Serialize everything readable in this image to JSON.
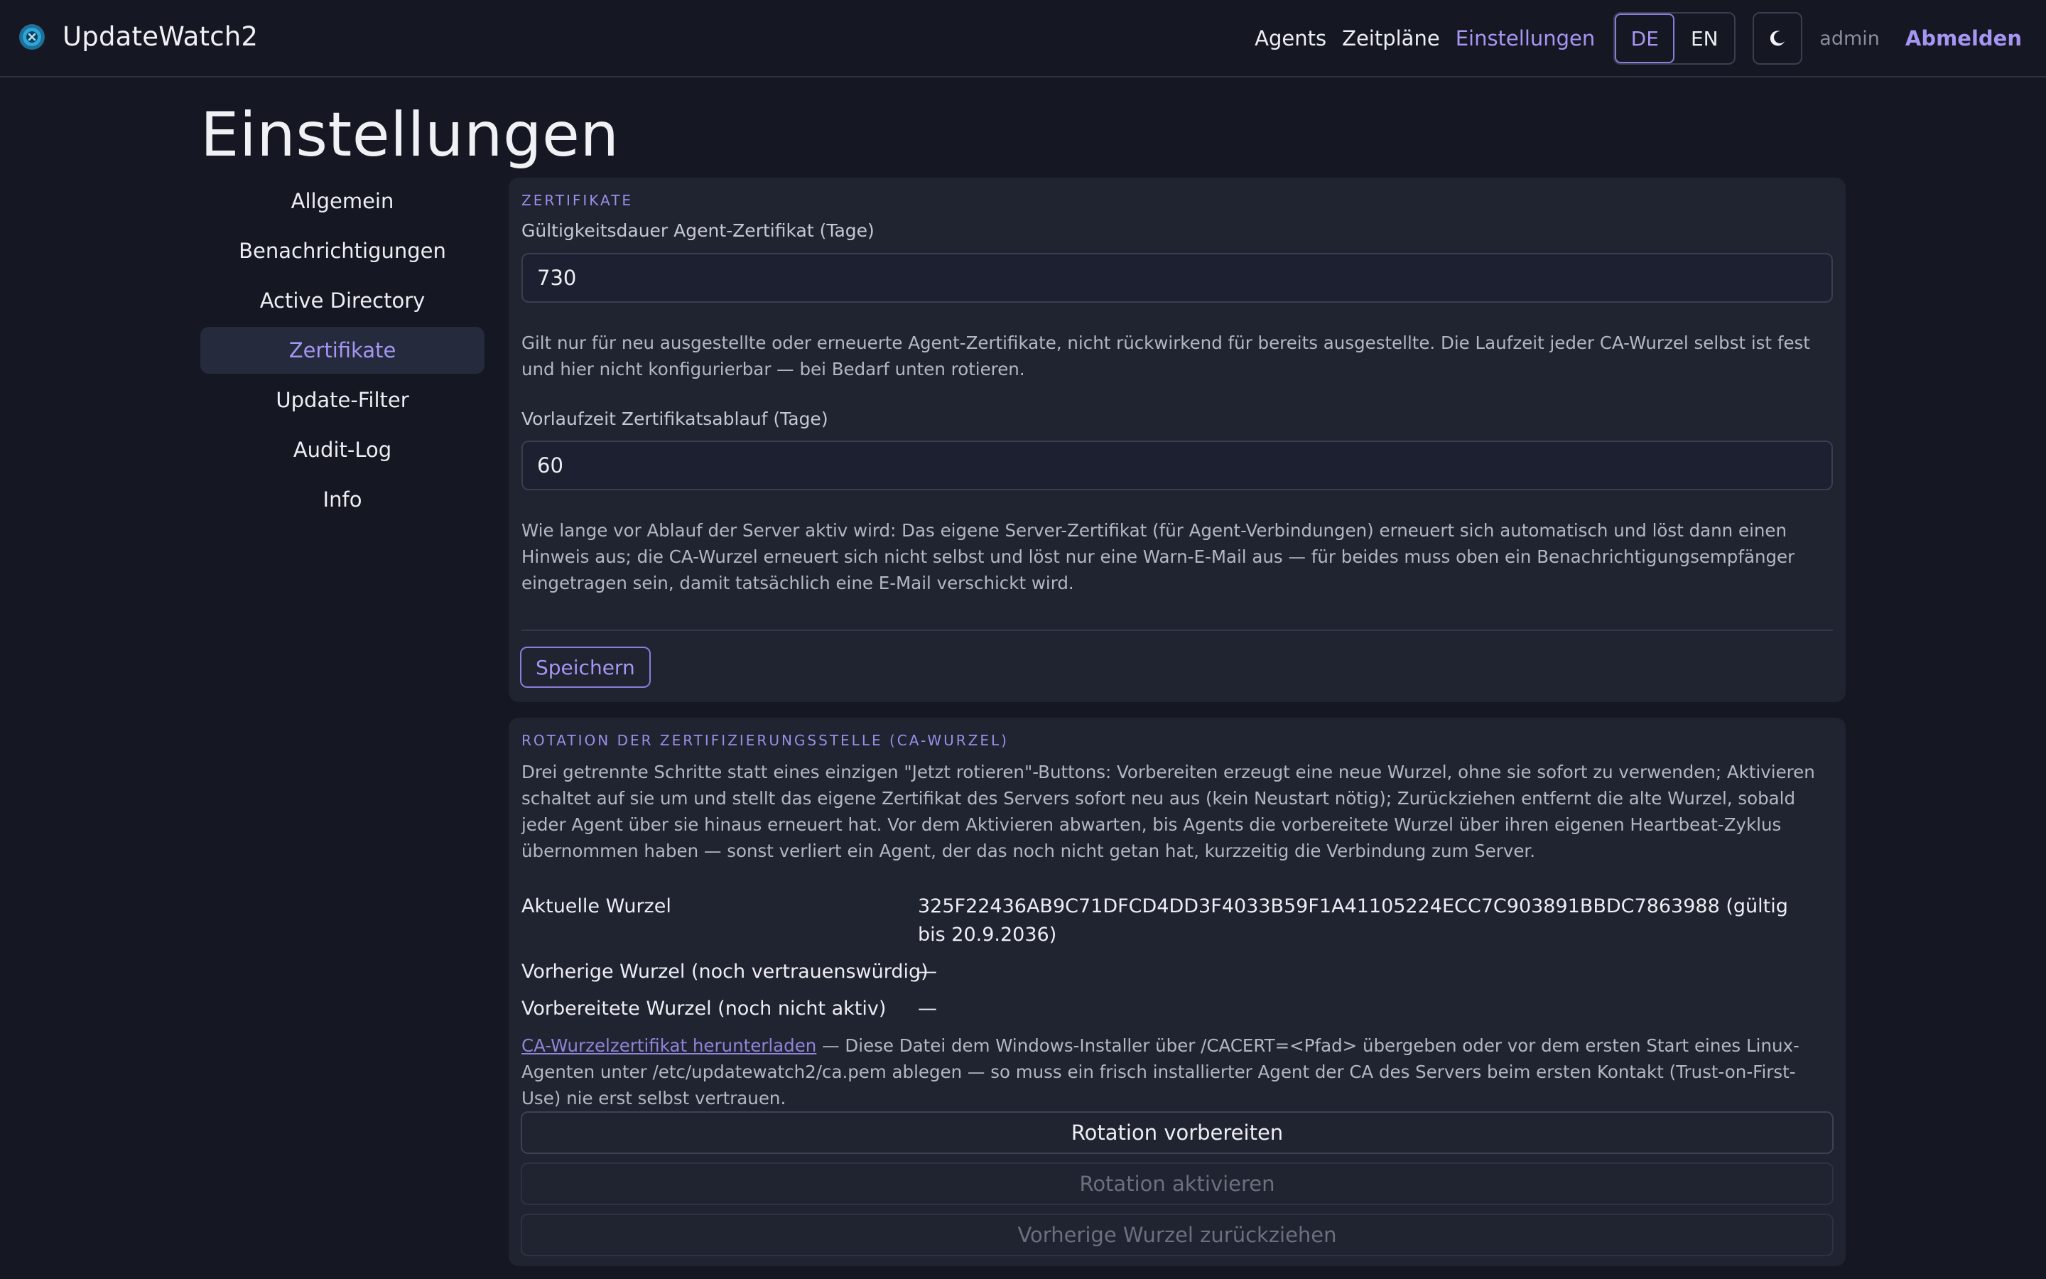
{
  "app": {
    "name": "UpdateWatch2",
    "logo_icon": "globe-shield-icon"
  },
  "nav": {
    "links": [
      "Agents",
      "Zeitpläne",
      "Einstellungen"
    ],
    "active_link": "Einstellungen",
    "languages": [
      "DE",
      "EN"
    ],
    "active_language": "DE",
    "theme_icon": "moon-icon",
    "user": "admin",
    "logout": "Abmelden"
  },
  "page": {
    "title": "Einstellungen"
  },
  "sidebar": {
    "items": [
      "Allgemein",
      "Benachrichtigungen",
      "Active Directory",
      "Zertifikate",
      "Update-Filter",
      "Audit-Log",
      "Info"
    ],
    "active": "Zertifikate"
  },
  "certificates": {
    "section_title": "ZERTIFIKATE",
    "validity_label": "Gültigkeitsdauer Agent-Zertifikat (Tage)",
    "validity_value": "730",
    "validity_help": "Gilt nur für neu ausgestellte oder erneuerte Agent-Zertifikate, nicht rückwirkend für bereits ausgestellte. Die Laufzeit jeder CA-Wurzel selbst ist fest und hier nicht konfigurierbar — bei Bedarf unten rotieren.",
    "lead_label": "Vorlaufzeit Zertifikatsablauf (Tage)",
    "lead_value": "60",
    "lead_help": "Wie lange vor Ablauf der Server aktiv wird: Das eigene Server-Zertifikat (für Agent-Verbindungen) erneuert sich automatisch und löst dann einen Hinweis aus; die CA-Wurzel erneuert sich nicht selbst und löst nur eine Warn-E-Mail aus — für beides muss oben ein Benachrichtigungsempfänger eingetragen sein, damit tatsächlich eine E-Mail verschickt wird.",
    "save_label": "Speichern"
  },
  "rotation": {
    "section_title": "ROTATION DER ZERTIFIZIERUNGSSTELLE (CA-WURZEL)",
    "description": "Drei getrennte Schritte statt eines einzigen \"Jetzt rotieren\"-Buttons: Vorbereiten erzeugt eine neue Wurzel, ohne sie sofort zu verwenden; Aktivieren schaltet auf sie um und stellt das eigene Zertifikat des Servers sofort neu aus (kein Neustart nötig); Zurückziehen entfernt die alte Wurzel, sobald jeder Agent über sie hinaus erneuert hat. Vor dem Aktivieren abwarten, bis Agents die vorbereitete Wurzel über ihren eigenen Heartbeat-Zyklus übernommen haben — sonst verliert ein Agent, der das noch nicht getan hat, kurzzeitig die Verbindung zum Server.",
    "rows": [
      {
        "key": "Aktuelle Wurzel",
        "value": "325F22436AB9C71DFCD4DD3F4033B59F1A41105224ECC7C903891BBDC7863988 (gültig bis 20.9.2036)"
      },
      {
        "key": "Vorherige Wurzel (noch vertrauenswürdig)",
        "value": "—"
      },
      {
        "key": "Vorbereitete Wurzel (noch nicht aktiv)",
        "value": "—"
      }
    ],
    "download_link": "CA-Wurzelzertifikat herunterladen",
    "download_text": " — Diese Datei dem Windows-Installer über /CACERT=<Pfad> übergeben oder vor dem ersten Start eines Linux-Agenten unter /etc/updatewatch2/ca.pem ablegen — so muss ein frisch installierter Agent der CA des Servers beim ersten Kontakt (Trust-on-First-Use) nie erst selbst vertrauen.",
    "prepare_label": "Rotation vorbereiten",
    "activate_label": "Rotation aktivieren",
    "retire_label": "Vorherige Wurzel zurückziehen"
  },
  "colors": {
    "background": "#151823",
    "card": "#202330",
    "accent": "#a496f2",
    "text": "#eceef3",
    "muted": "#b4b7c3"
  }
}
